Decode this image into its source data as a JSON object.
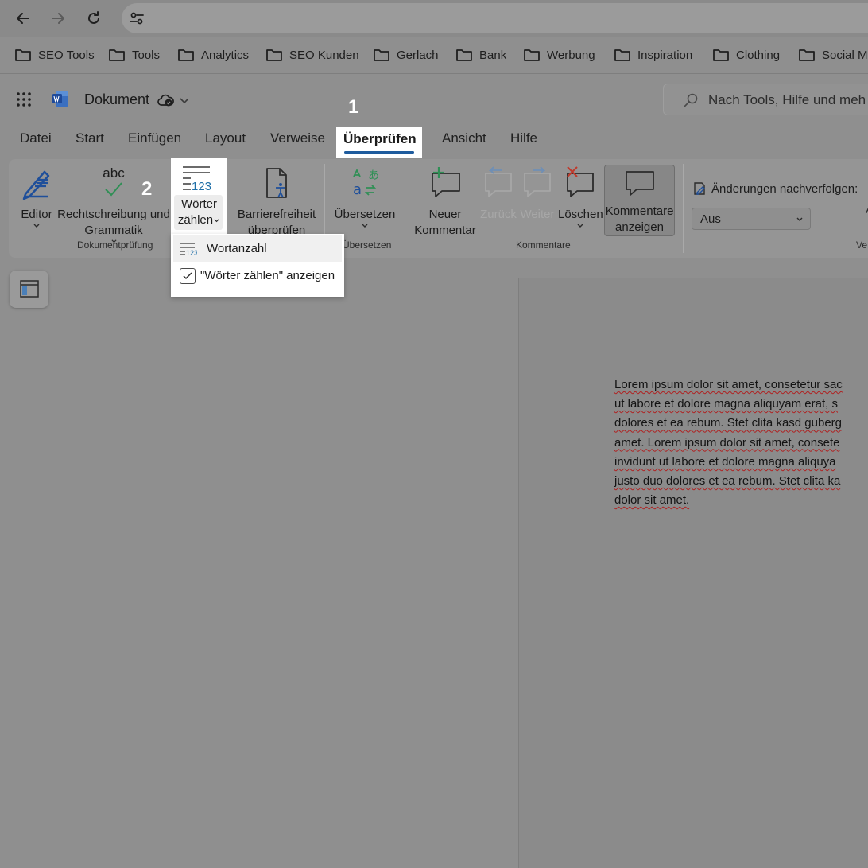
{
  "browser": {
    "bookmarks": [
      "SEO Tools",
      "Tools",
      "Analytics",
      "SEO Kunden",
      "Gerlach",
      "Bank",
      "Werbung",
      "Inspiration",
      "Clothing",
      "Social M"
    ]
  },
  "app": {
    "doc_title": "Dokument",
    "search_placeholder": "Nach Tools, Hilfe und meh"
  },
  "tabs": [
    "Datei",
    "Start",
    "Einfügen",
    "Layout",
    "Verweise",
    "Überprüfen",
    "Ansicht",
    "Hilfe"
  ],
  "active_tab": "Überprüfen",
  "callouts": {
    "one": "1",
    "two": "2"
  },
  "ribbon": {
    "editor": "Editor",
    "spelling_line1": "Rechtschreibung und",
    "spelling_line2": "Grammatik",
    "abc": "abc",
    "word_count_line1": "Wörter",
    "word_count_line2": "zählen",
    "word_count_icon_num": "123",
    "access_line1": "Barrierefreiheit",
    "access_line2": "überprüfen",
    "translate": "Übersetzen",
    "new_comment_line1": "Neuer",
    "new_comment_line2": "Kommentar",
    "back": "Zurück",
    "next": "Weiter",
    "delete": "Löschen",
    "show_comments_line1": "Kommentare",
    "show_comments_line2": "anzeigen",
    "track_changes": "Änderungen nachverfolgen:",
    "track_value": "Aus",
    "group_proofing": "Dokumentprüfung",
    "group_translate": "Übersetzen",
    "group_comments": "Kommentare",
    "group_cut_right": "Ve",
    "cut_right_char": "A"
  },
  "dropdown": {
    "item1": "Wortanzahl",
    "item2": "\"Wörter zählen\" anzeigen",
    "item2_checked": true
  },
  "document": {
    "lines": [
      "Lorem ipsum dolor sit amet, consetetur sac",
      "ut labore et dolore magna aliquyam erat, s",
      "dolores et ea rebum. Stet clita kasd guberg",
      "amet. Lorem ipsum dolor sit amet, consete",
      "invidunt ut labore et dolore magna aliquya",
      "justo duo dolores et ea rebum. Stet clita ka",
      "dolor sit amet."
    ]
  }
}
